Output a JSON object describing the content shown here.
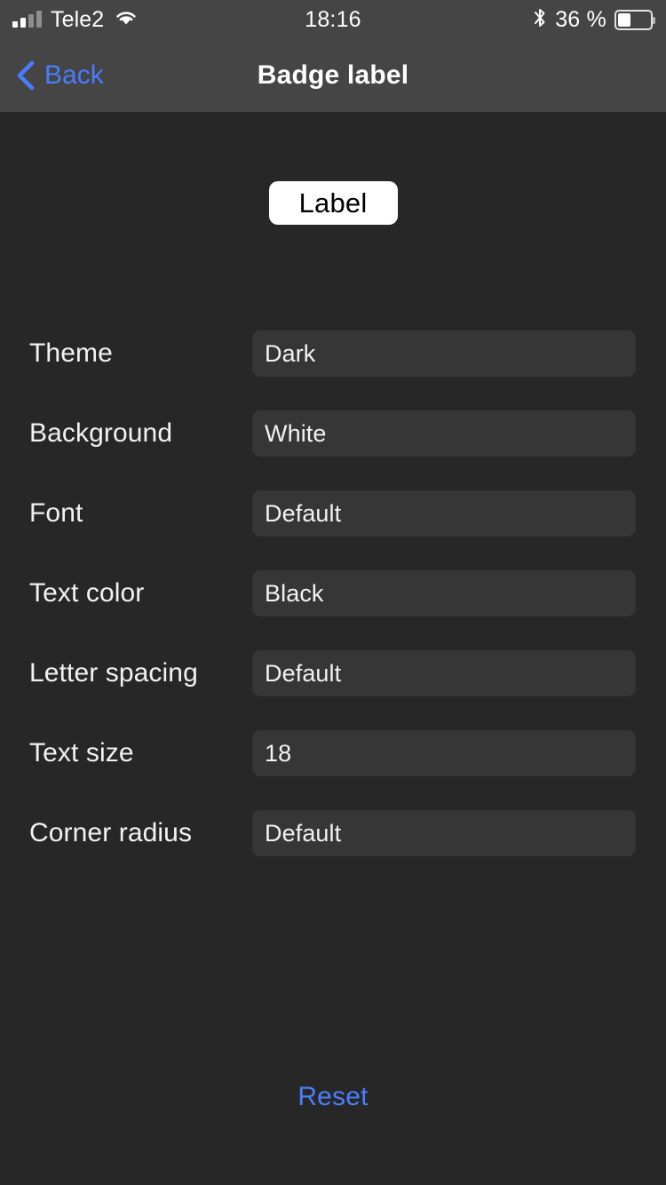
{
  "status_bar": {
    "carrier": "Tele2",
    "time": "18:16",
    "battery_percent": "36 %",
    "battery_level": 36,
    "signal_bars_filled": 2,
    "signal_bars_total": 4,
    "wifi_icon": "wifi-icon",
    "bluetooth_icon": "bluetooth-icon",
    "battery_icon": "battery-icon"
  },
  "navbar": {
    "back_label": "Back",
    "back_icon": "chevron-left-icon",
    "title": "Badge label"
  },
  "preview": {
    "badge_text": "Label",
    "badge_background": "#ffffff",
    "badge_text_color": "#000000",
    "badge_corner_radius": "10px"
  },
  "settings": {
    "rows": [
      {
        "label": "Theme",
        "value": "Dark",
        "placeholder": "Default"
      },
      {
        "label": "Background",
        "value": "White",
        "placeholder": "Default"
      },
      {
        "label": "Font",
        "value": "Default",
        "placeholder": "Default"
      },
      {
        "label": "Text color",
        "value": "Black",
        "placeholder": "Default"
      },
      {
        "label": "Letter spacing",
        "value": "Default",
        "placeholder": "Default"
      },
      {
        "label": "Text size",
        "value": "18",
        "placeholder": "Default"
      },
      {
        "label": "Corner radius",
        "value": "Default",
        "placeholder": "Default"
      }
    ]
  },
  "footer": {
    "reset_label": "Reset"
  },
  "colors": {
    "screen_background": "#272727",
    "bar_background": "#454545",
    "field_background": "#363636",
    "accent_blue": "#4a7dfc",
    "primary_text": "#f2f2f2"
  }
}
